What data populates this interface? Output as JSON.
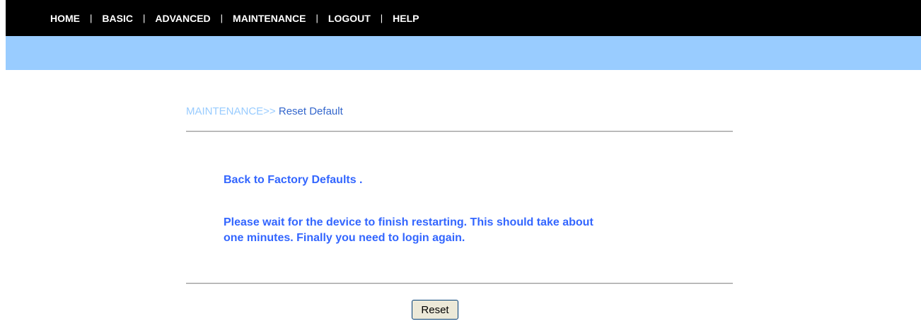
{
  "nav": {
    "items": [
      {
        "label": "HOME"
      },
      {
        "label": "BASIC"
      },
      {
        "label": "ADVANCED"
      },
      {
        "label": "MAINTENANCE"
      },
      {
        "label": "LOGOUT"
      },
      {
        "label": "HELP"
      }
    ],
    "separator": "|"
  },
  "breadcrumb": {
    "section": "MAINTENANCE>>",
    "page": " Reset Default"
  },
  "content": {
    "title": "Back to Factory Defaults .",
    "message": "Please wait for the device to finish restarting. This should take about one minutes. Finally you need to login again."
  },
  "actions": {
    "reset_label": "Reset"
  },
  "colors": {
    "nav_bg": "#000000",
    "subbar_bg": "#99ccff",
    "message_text": "#3366ff",
    "breadcrumb_section": "#99ccff",
    "breadcrumb_page": "#3366cc"
  }
}
